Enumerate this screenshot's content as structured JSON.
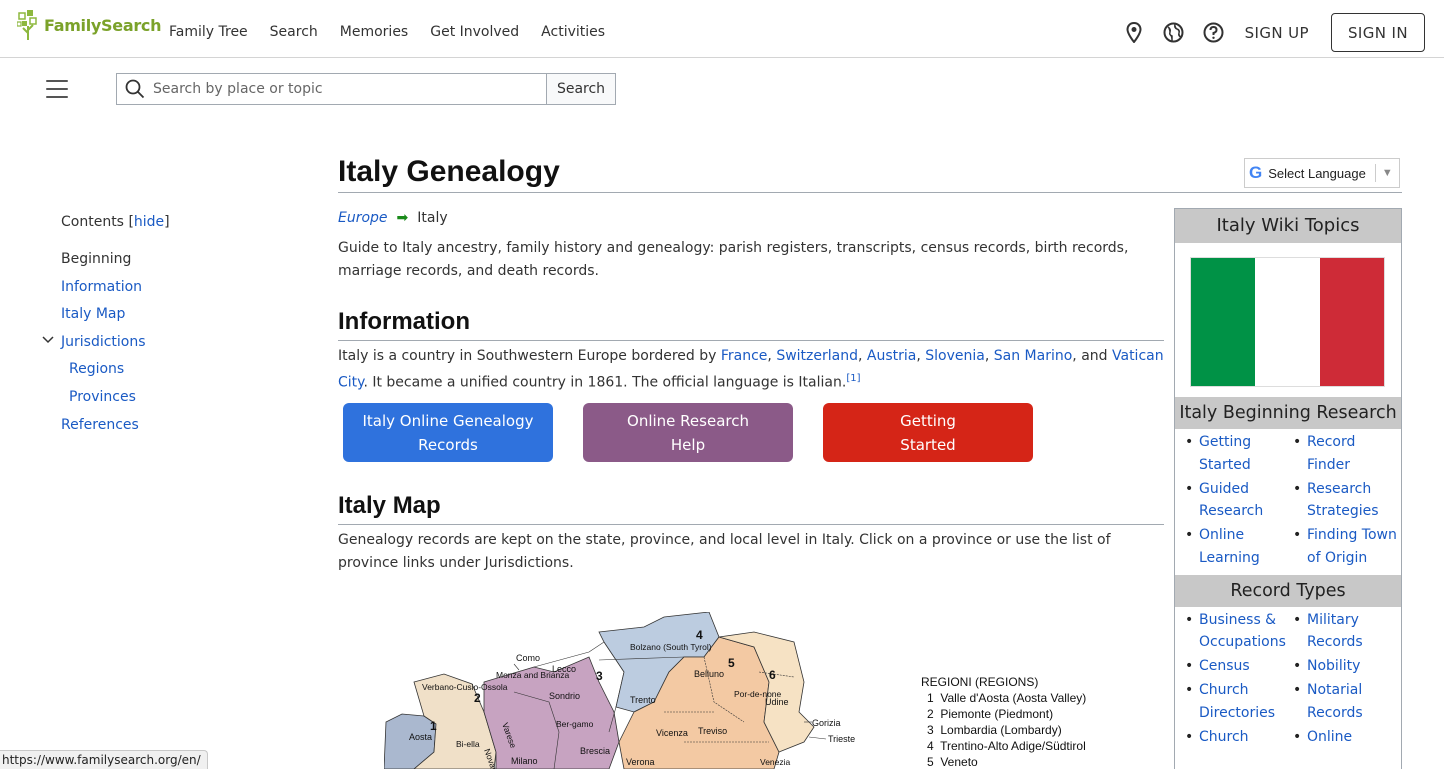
{
  "topnav": {
    "logo_text": "FamilySearch",
    "links": [
      "Family Tree",
      "Search",
      "Memories",
      "Get Involved",
      "Activities"
    ],
    "sign_up": "SIGN UP",
    "sign_in": "SIGN IN",
    "icons": [
      "location-pin-icon",
      "globe-icon",
      "help-icon"
    ]
  },
  "search": {
    "placeholder": "Search by place or topic",
    "value": "",
    "button_label": "Search"
  },
  "language_selector": {
    "label": "Select Language",
    "caret": "▼"
  },
  "toc": {
    "title": "Contents",
    "toggle": "hide",
    "items": [
      {
        "label": "Beginning"
      },
      {
        "label": "Information"
      },
      {
        "label": "Italy Map"
      },
      {
        "label": "Jurisdictions"
      },
      {
        "label": "Regions"
      },
      {
        "label": "Provinces"
      },
      {
        "label": "References"
      }
    ]
  },
  "page": {
    "title": "Italy Genealogy",
    "breadcrumb": {
      "parent": "Europe",
      "current": "Italy"
    },
    "intro": "Guide to Italy ancestry, family history and genealogy: parish registers, transcripts, census records, birth records, marriage records, and death records.",
    "info_heading": "Information",
    "info_text_1": "Italy is a country in Southwestern Europe bordered by ",
    "info_links": [
      "France",
      "Switzerland",
      "Austria",
      "Slovenia",
      "San Marino",
      "Vatican City"
    ],
    "info_sep_comma": ", ",
    "info_sep_and": ", and ",
    "info_text_2": ". It became a unified country in 1861. The official language is Italian.",
    "info_ref": "[1]",
    "buttons": [
      {
        "label": "Italy Online Genealogy Records",
        "color": "#2f72dd"
      },
      {
        "label": "Online Research Help",
        "color": "#8b5a88"
      },
      {
        "label": "Getting Started",
        "color": "#d52517"
      }
    ],
    "map_heading": "Italy Map",
    "map_text": "Genealogy records are kept on the state, province, and local level in Italy. Click on a province or use the list of province links under Jurisdictions."
  },
  "map": {
    "labels": [
      "Como",
      "Lecco",
      "Monza and Brianza",
      "Verbano-Cusio-Ossola",
      "Sondrio",
      "Bolzano (South Tyrol)",
      "Trento",
      "Belluno",
      "Por-de-none",
      "Udine",
      "Gorizia",
      "Trieste",
      "Aosta",
      "Bi-ella",
      "Novara",
      "Varese",
      "Ber-gamo",
      "Brescia",
      "Milano",
      "Vicenza",
      "Treviso",
      "Verona",
      "Venezia"
    ],
    "numbers": [
      "1",
      "2",
      "3",
      "4",
      "5",
      "6"
    ],
    "legend_title": "REGIONI (REGIONS)",
    "legend": [
      "1  Valle d'Aosta (Aosta Valley)",
      "2  Piemonte (Piedmont)",
      "3  Lombardia (Lombardy)",
      "4  Trentino-Alto Adige/Südtirol",
      "5  Veneto"
    ]
  },
  "infobox": {
    "title": "Italy Wiki Topics",
    "flag_colors": [
      "#009246",
      "#ffffff",
      "#ce2b37"
    ],
    "beginning_heading": "Italy Beginning Research",
    "beginning_items": [
      "Getting Started",
      "Record Finder",
      "Guided Research",
      "Research Strategies",
      "Online Learning",
      "Finding Town of Origin"
    ],
    "records_heading": "Record Types",
    "records_items": [
      "Business & Occupations",
      "Military Records",
      "Census",
      "Nobility",
      "Church Directories",
      "Notarial Records",
      "Church",
      "Online"
    ]
  },
  "statusbar": {
    "url": "https://www.familysearch.org/en/"
  }
}
